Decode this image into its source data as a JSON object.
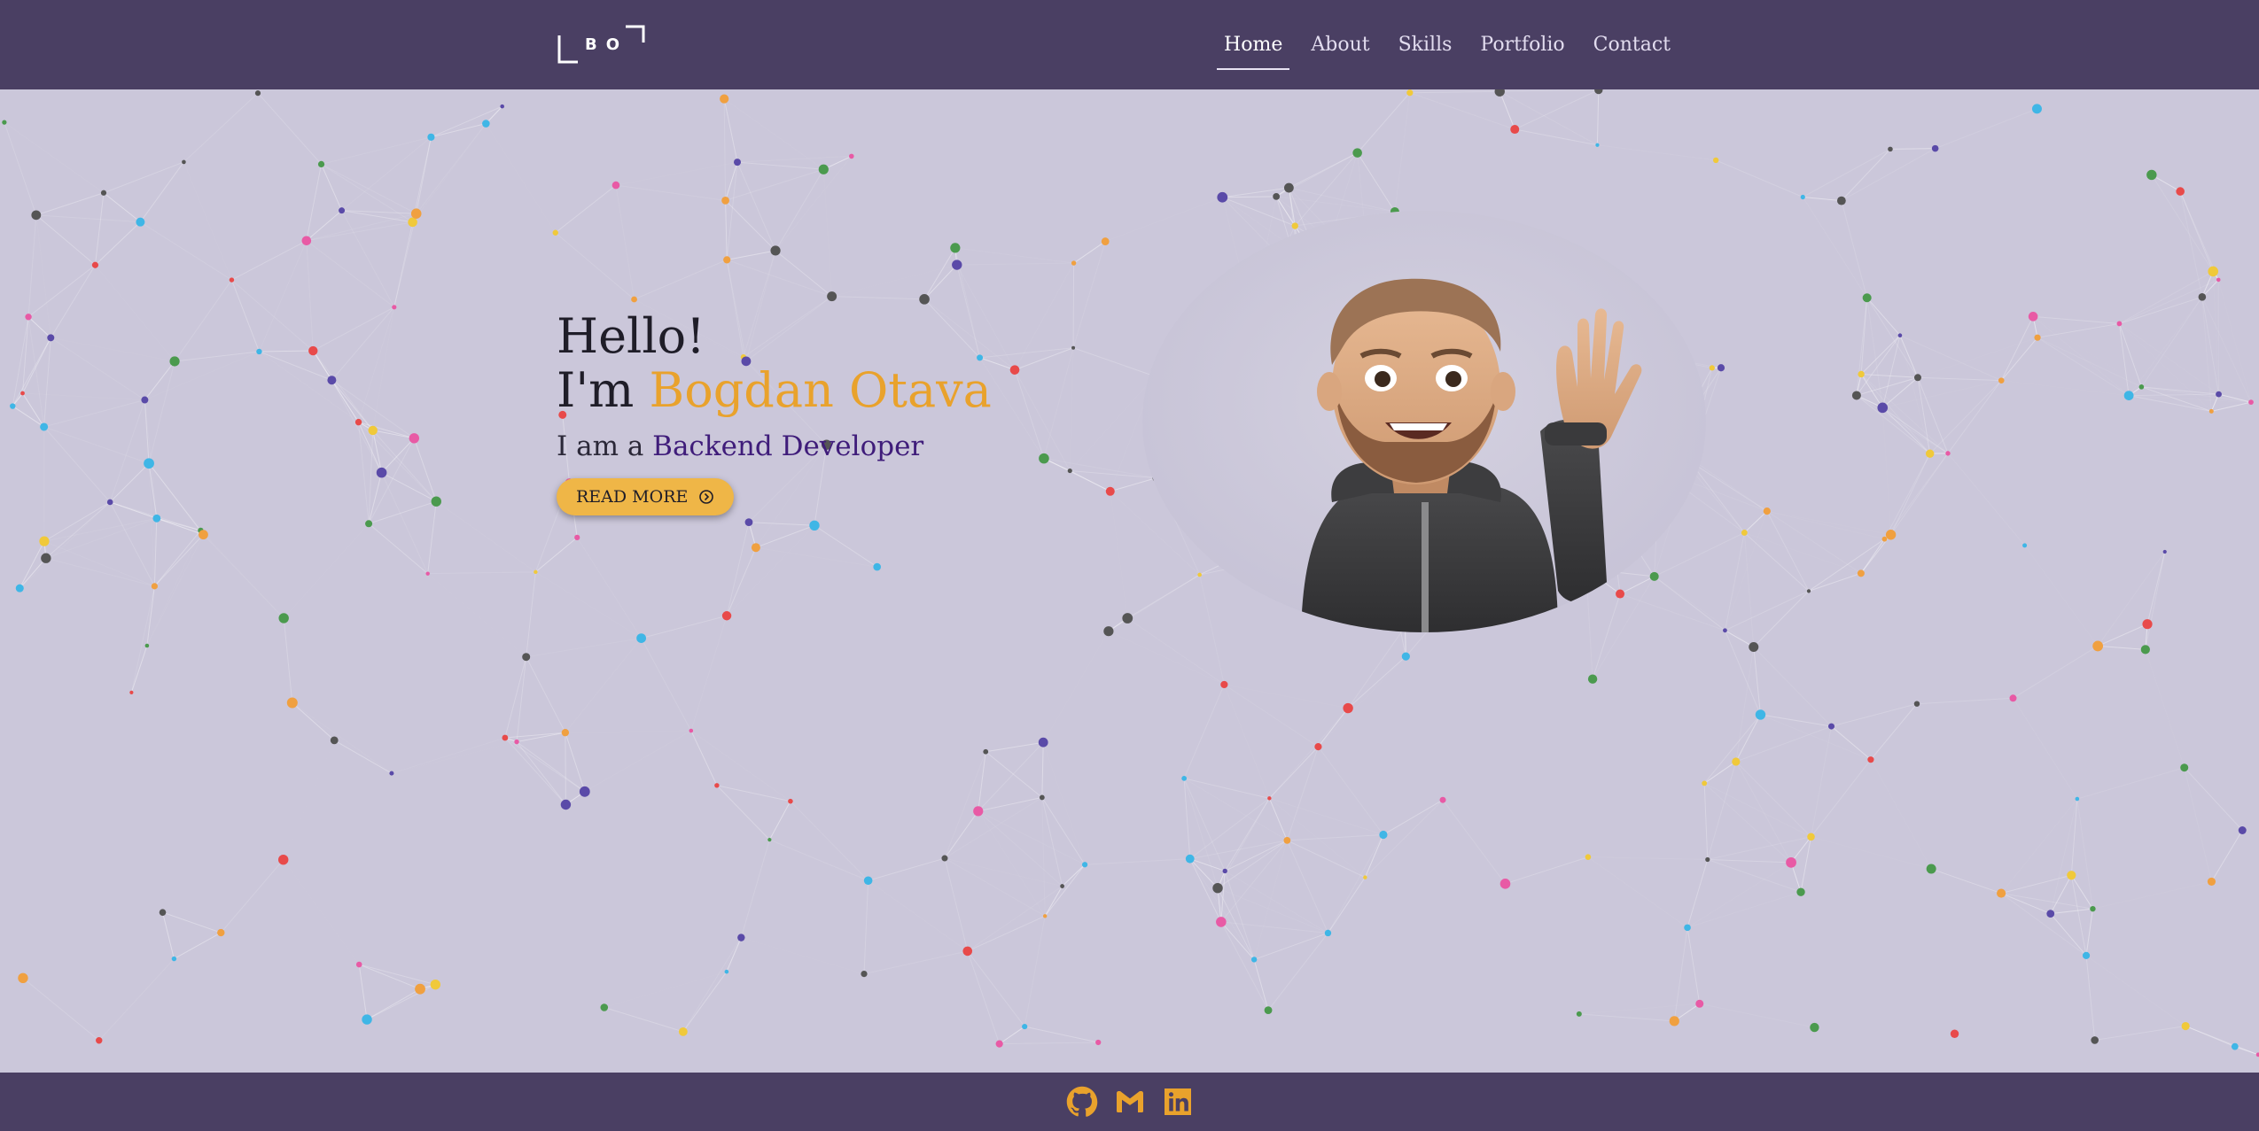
{
  "header": {
    "logo_text": "BO",
    "nav": [
      {
        "label": "Home",
        "active": true
      },
      {
        "label": "About",
        "active": false
      },
      {
        "label": "Skills",
        "active": false
      },
      {
        "label": "Portfolio",
        "active": false
      },
      {
        "label": "Contact",
        "active": false
      }
    ]
  },
  "hero": {
    "greeting": "Hello!",
    "intro_prefix": "I'm ",
    "name": "Bogdan Otava",
    "role_prefix": "I am a ",
    "role": "Backend Developer",
    "button_label": "READ MORE",
    "button_icon": "circle-arrow-icon"
  },
  "avatar": {
    "icon": "waving-memoji-avatar"
  },
  "footer": {
    "socials": [
      {
        "icon": "github-icon"
      },
      {
        "icon": "gmail-icon"
      },
      {
        "icon": "linkedin-icon"
      }
    ]
  },
  "colors": {
    "header_bg": "#4a3f63",
    "page_bg": "#cbc7da",
    "accent": "#e9a22c",
    "role_color": "#3f1c7a",
    "button_bg": "#efb647"
  }
}
